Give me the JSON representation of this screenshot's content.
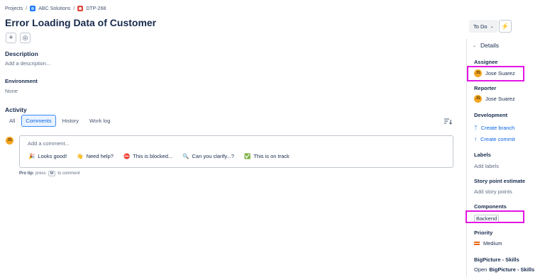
{
  "breadcrumb": {
    "items": [
      "Projects",
      "ABC Solutions",
      "DTP-268"
    ],
    "separator": "/"
  },
  "issue": {
    "title": "Error Loading Data of Customer"
  },
  "toolbar": {
    "add_icon": "+",
    "watch_icon": "◎"
  },
  "description": {
    "heading": "Description",
    "placeholder": "Add a description..."
  },
  "environment": {
    "heading": "Environment",
    "value": "None"
  },
  "activity": {
    "heading": "Activity",
    "tabs": [
      {
        "label": "All",
        "active": false
      },
      {
        "label": "Comments",
        "active": true
      },
      {
        "label": "History",
        "active": false
      },
      {
        "label": "Work log",
        "active": false
      }
    ],
    "sort_icon": "sort-icon"
  },
  "comment": {
    "avatar_initials": "JS",
    "placeholder": "Add a comment...",
    "quick_replies": [
      {
        "emoji": "🎉",
        "label": "Looks good!"
      },
      {
        "emoji": "👋",
        "label": "Need help?"
      },
      {
        "emoji": "⛔",
        "label": "This is blocked..."
      },
      {
        "emoji": "🔍",
        "label": "Can you clarify...?"
      },
      {
        "emoji": "✅",
        "label": "This is on track"
      }
    ],
    "pro_tip": {
      "bold": "Pro tip:",
      "before": "press",
      "key": "M",
      "after": "to comment"
    }
  },
  "status": {
    "label": "To Do",
    "chevron": "⌄",
    "bolt_icon": "⚡"
  },
  "details": {
    "heading": "Details",
    "assignee": {
      "label": "Assignee",
      "name": "Jose Suarez",
      "initials": "JS"
    },
    "reporter": {
      "label": "Reporter",
      "name": "Jose Suarez",
      "initials": "JS"
    },
    "development": {
      "label": "Development",
      "create_branch": "Create branch",
      "create_commit": "Create commit"
    },
    "labels": {
      "label": "Labels",
      "value": "Add labels"
    },
    "story_points": {
      "label": "Story point estimate",
      "value": "Add story points"
    },
    "components": {
      "label": "Components",
      "value": "Backend"
    },
    "priority": {
      "label": "Priority",
      "value": "Medium"
    },
    "bigpicture": {
      "label": "BigPicture - Skills",
      "prefix": "Open",
      "link": "BigPicture - Skills"
    }
  },
  "colors": {
    "accent": "#0c66e4",
    "highlight": "#e414e4",
    "avatar": "#f5a623",
    "priority_medium": "#e56910"
  }
}
